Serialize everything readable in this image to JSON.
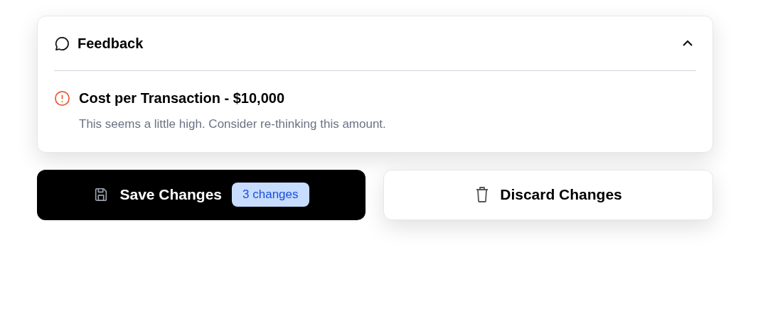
{
  "feedback": {
    "title": "Feedback",
    "expanded": true,
    "items": [
      {
        "title": "Cost per Transaction - $10,000",
        "message": "This seems a little high. Consider re-thinking this amount."
      }
    ]
  },
  "actions": {
    "save": {
      "label": "Save Changes",
      "badge": "3 changes"
    },
    "discard": {
      "label": "Discard Changes"
    }
  }
}
